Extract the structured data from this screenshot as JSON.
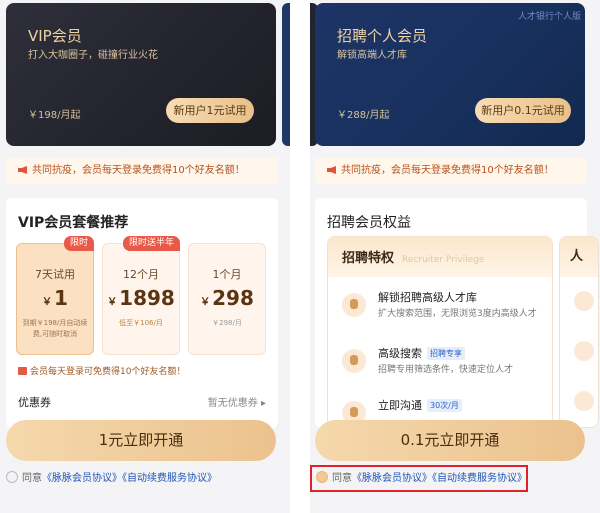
{
  "left": {
    "card": {
      "title": "VIP会员",
      "subtitle": "打入大咖圈子，碰撞行业火花",
      "price": "￥198/月起",
      "button": "新用户1元试用"
    },
    "notice": "共同抗疫，会员每天登录免费得10个好友名额！",
    "section_title": "VIP会员套餐推荐",
    "plans": [
      {
        "tag": "限时",
        "name": "7天试用",
        "currency": "￥",
        "price": "1",
        "note": "到期￥198/月自动续费,可随时取消"
      },
      {
        "tag": "限时送半年",
        "name": "12个月",
        "currency": "￥",
        "price": "1898",
        "note": "低至￥106/月"
      },
      {
        "tag": "",
        "name": "1个月",
        "currency": "￥",
        "price": "298",
        "note": "￥298/月"
      }
    ],
    "gift_text": "会员每天登录可免费得10个好友名额！",
    "coupon_label": "优惠券",
    "coupon_value": "暂无优惠券 ▸",
    "cta": "1元立即开通",
    "agree_prefix": "同意",
    "agree_link1": "《脉脉会员协议》",
    "agree_link2": "《自动续费服务协议》"
  },
  "right": {
    "card": {
      "title": "招聘个人会员",
      "subtitle": "解锁高端人才库",
      "price": "￥288/月起",
      "button": "新用户0.1元试用",
      "corner": "人才银行个人版"
    },
    "notice": "共同抗疫，会员每天登录免费得10个好友名额！",
    "section_title": "招聘会员权益",
    "benefit_head": "招聘特权",
    "benefit_head_en": "Recruiter Privilege",
    "peek_head": "人",
    "benefits": [
      {
        "title": "解锁招聘高级人才库",
        "badge": "",
        "desc": "扩大搜索范围，无限浏览3度内高级人才"
      },
      {
        "title": "高级搜索",
        "badge": "招聘专享",
        "desc": "招聘专用筛选条件，快速定位人才"
      },
      {
        "title": "立即沟通",
        "badge": "30次/月",
        "desc": ""
      }
    ],
    "cta": "0.1元立即开通",
    "agree_prefix": "同意",
    "agree_link1": "《脉脉会员协议》",
    "agree_link2": "《自动续费服务协议》"
  }
}
